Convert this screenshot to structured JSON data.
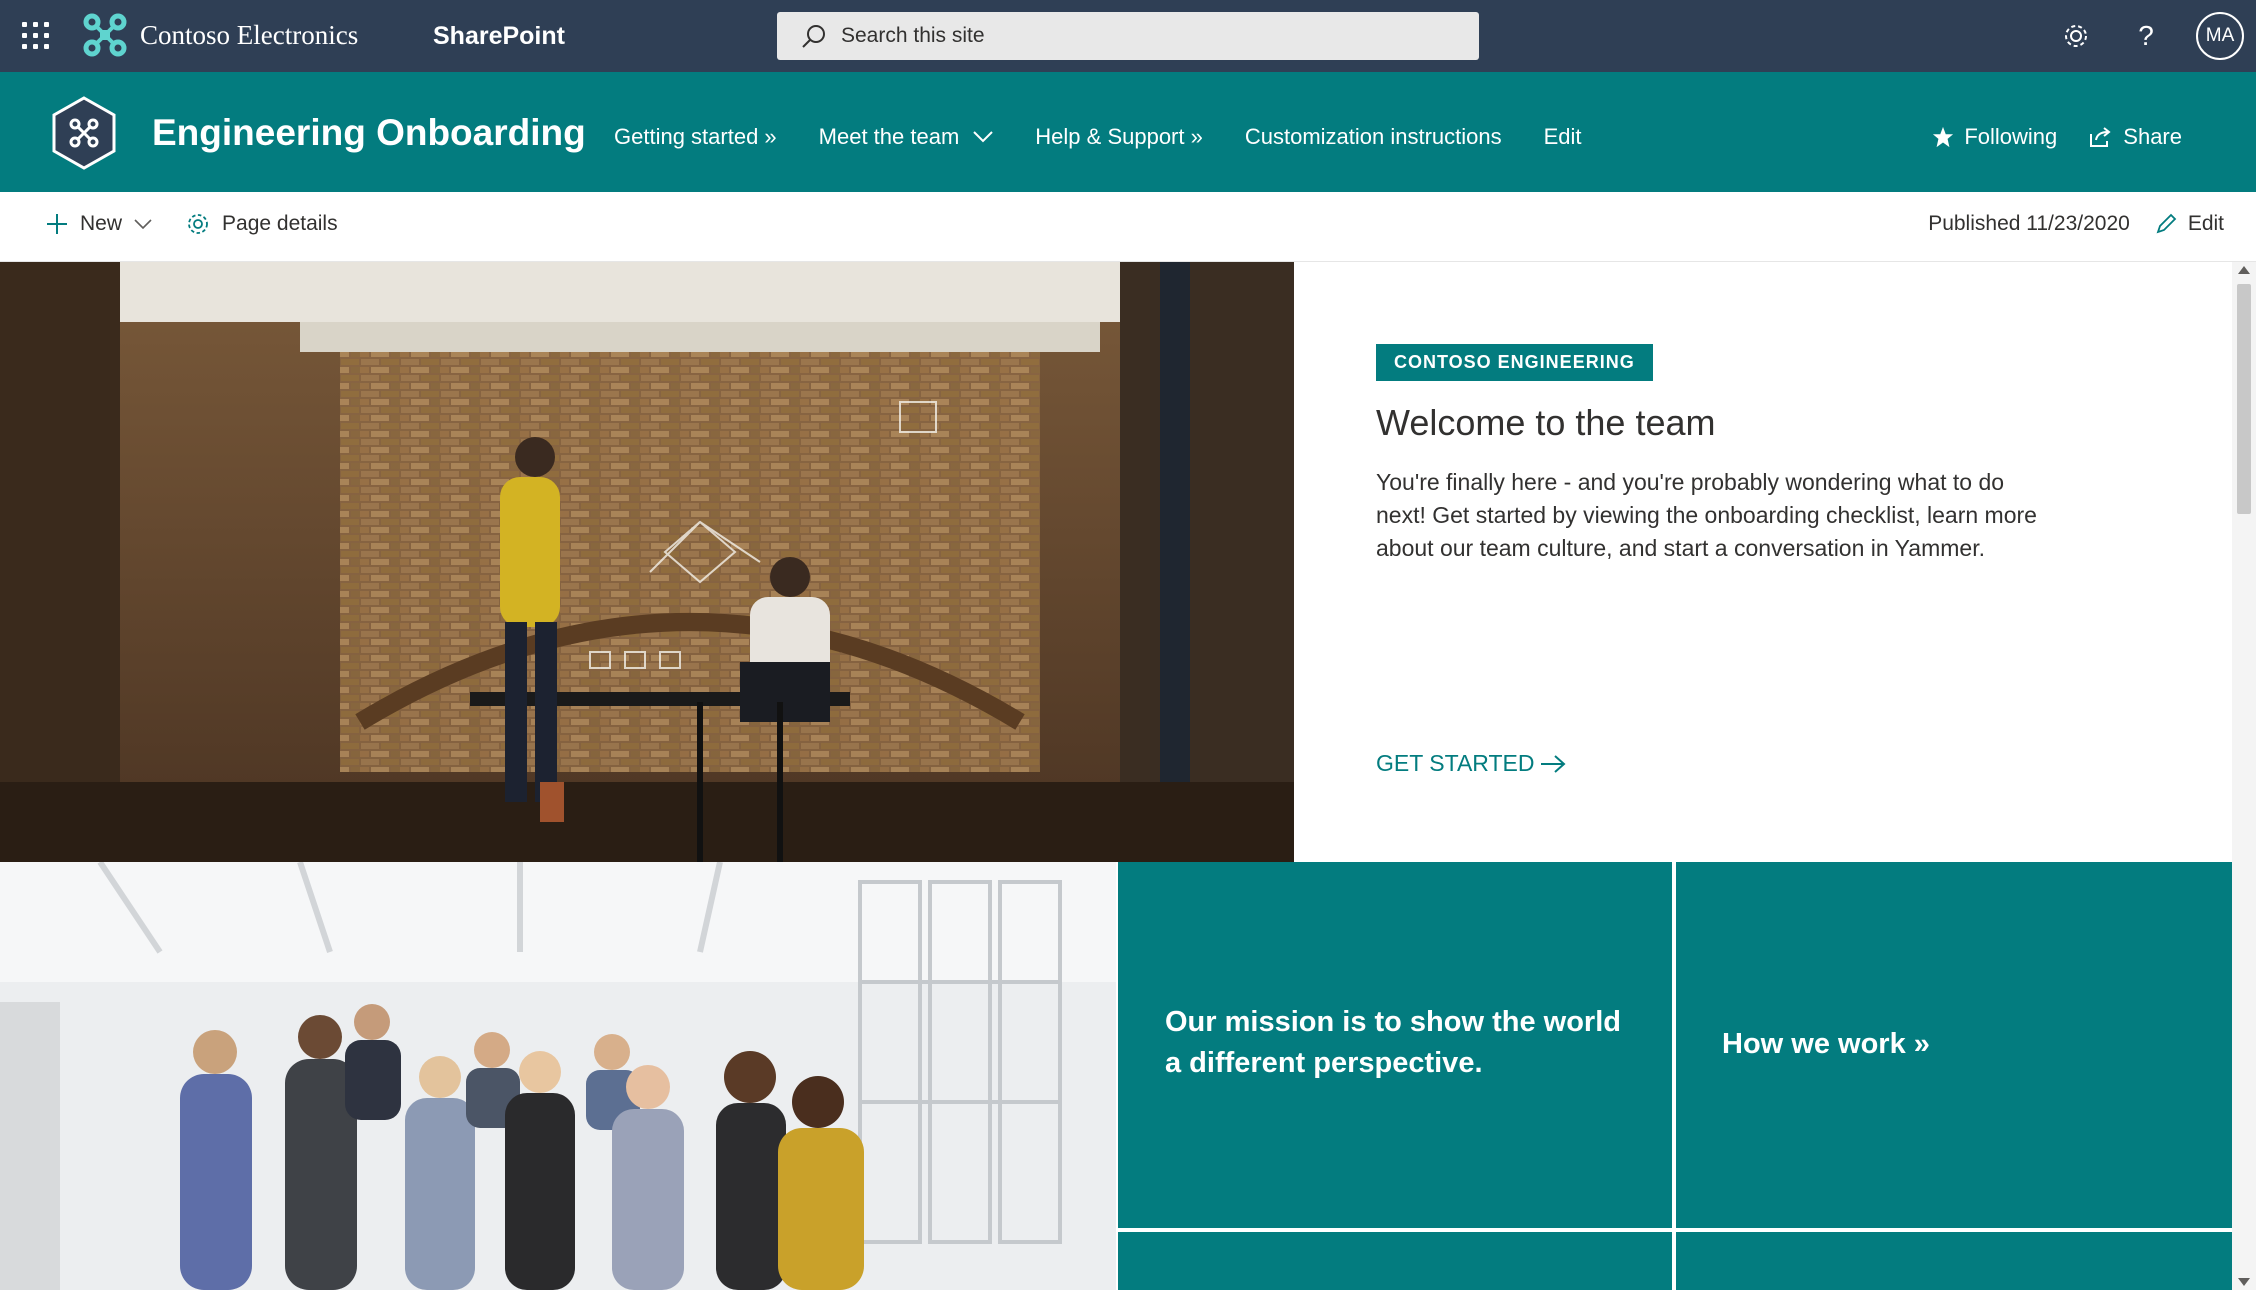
{
  "suite_bar": {
    "org_name": "Contoso Electronics",
    "app_name": "SharePoint",
    "search_placeholder": "Search this site",
    "avatar_initials": "MA",
    "background_color": "#2f3f55"
  },
  "site_header": {
    "title": "Engineering Onboarding",
    "background_color": "#037c7f",
    "nav": [
      {
        "label": "Getting started »"
      },
      {
        "label": "Meet the team"
      },
      {
        "label": "Help & Support »"
      },
      {
        "label": "Customization instructions"
      },
      {
        "label": "Edit"
      }
    ],
    "following_label": "Following",
    "share_label": "Share"
  },
  "command_bar": {
    "new_label": "New",
    "page_details_label": "Page details",
    "published": "Published 11/23/2020",
    "edit_label": "Edit"
  },
  "hero": {
    "tag": "CONTOSO ENGINEERING",
    "title": "Welcome to the team",
    "body": "You're finally here - and you're probably wondering what to do next! Get started by viewing the onboarding checklist, learn more about our team culture, and start a conversation in Yammer.",
    "cta": "GET STARTED"
  },
  "tiles": {
    "mission": "Our mission is to show the world a different perspective.",
    "how_we_work": "How we work »"
  },
  "icons": {
    "waffle": "app-launcher-icon",
    "settings": "gear-icon",
    "help": "question-icon",
    "search": "search-icon",
    "star": "star-icon",
    "share": "share-icon",
    "add": "plus-icon",
    "pencil": "pencil-icon",
    "arrow": "arrow-right-icon"
  }
}
